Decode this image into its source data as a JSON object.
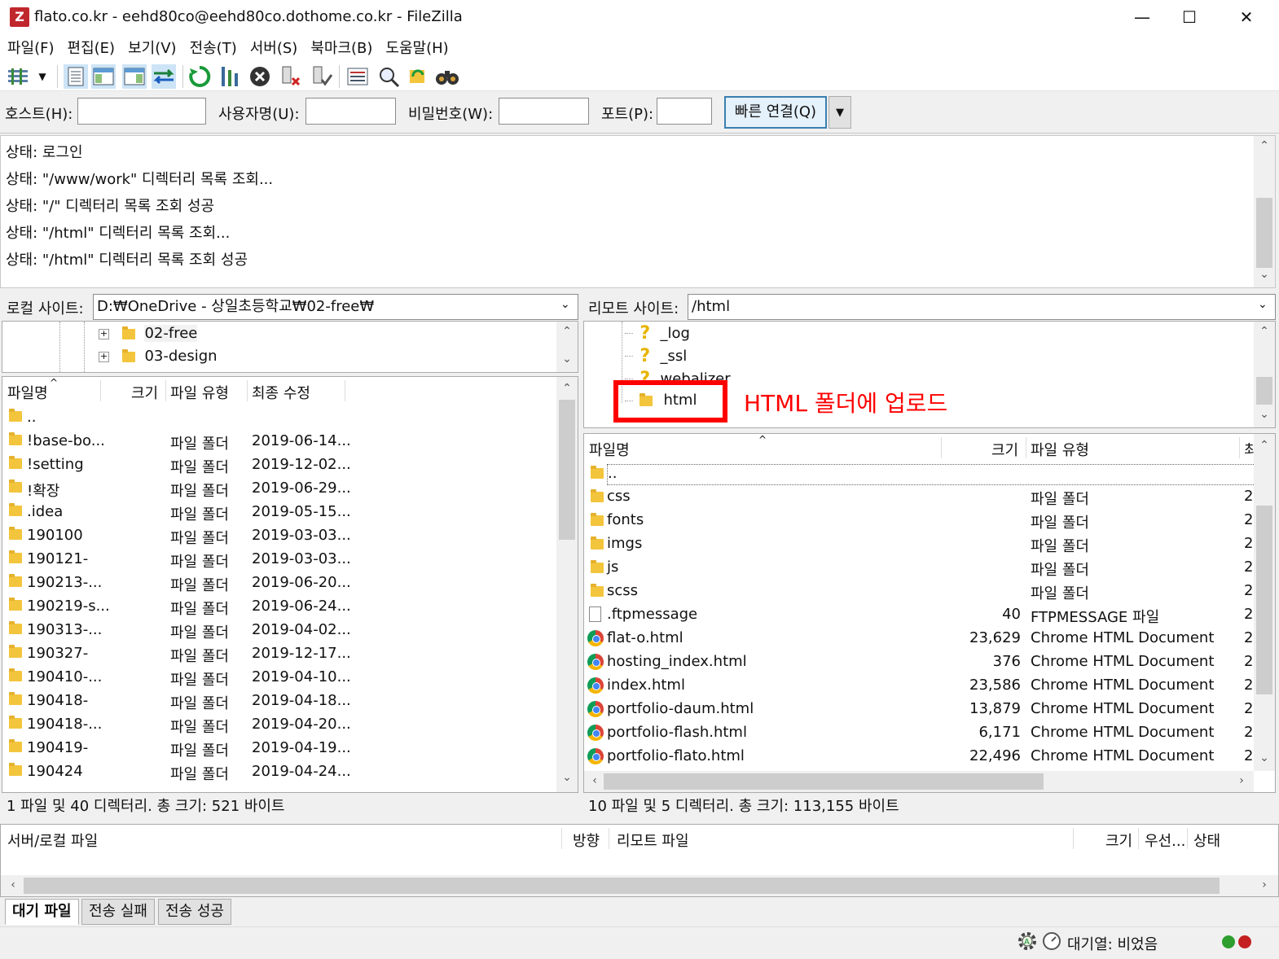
{
  "window": {
    "title": "flato.co.kr - eehd80co@eehd80co.dothome.co.kr - FileZilla",
    "app_icon": "Z",
    "minimize": "—",
    "maximize": "☐",
    "close": "✕"
  },
  "menu": [
    "파일(F)",
    "편집(E)",
    "보기(V)",
    "전송(T)",
    "서버(S)",
    "북마크(B)",
    "도움말(H)"
  ],
  "quickconnect": {
    "host_label": "호스트(H):",
    "user_label": "사용자명(U):",
    "pass_label": "비밀번호(W):",
    "port_label": "포트(P):",
    "host_value": "",
    "user_value": "",
    "pass_value": "",
    "port_value": "",
    "button_label": "빠른 연결(Q)"
  },
  "log": [
    "상태: 로그인",
    "상태: \"/www/work\" 디렉터리 목록 조회...",
    "상태: \"/\" 디렉터리 목록 조회 성공",
    "상태: \"/html\" 디렉터리 목록 조회...",
    "상태: \"/html\" 디렉터리 목록 조회 성공"
  ],
  "local": {
    "site_label": "로컬 사이트:",
    "path": "D:₩OneDrive - 상일초등학교₩02-free₩",
    "tree": [
      "02-free",
      "03-design"
    ],
    "columns": {
      "name": "파일명",
      "size": "크기",
      "type": "파일 유형",
      "modified": "최종 수정"
    },
    "rows": [
      {
        "name": "..",
        "type": "",
        "modified": ""
      },
      {
        "name": "!base-bo...",
        "type": "파일 폴더",
        "modified": "2019-06-14..."
      },
      {
        "name": "!setting",
        "type": "파일 폴더",
        "modified": "2019-12-02..."
      },
      {
        "name": "!확장",
        "type": "파일 폴더",
        "modified": "2019-06-29..."
      },
      {
        "name": ".idea",
        "type": "파일 폴더",
        "modified": "2019-05-15..."
      },
      {
        "name": "190100",
        "type": "파일 폴더",
        "modified": "2019-03-03..."
      },
      {
        "name": "190121-",
        "type": "파일 폴더",
        "modified": "2019-03-03..."
      },
      {
        "name": "190213-...",
        "type": "파일 폴더",
        "modified": "2019-06-20..."
      },
      {
        "name": "190219-s...",
        "type": "파일 폴더",
        "modified": "2019-06-24..."
      },
      {
        "name": "190313-...",
        "type": "파일 폴더",
        "modified": "2019-04-02..."
      },
      {
        "name": "190327-",
        "type": "파일 폴더",
        "modified": "2019-12-17..."
      },
      {
        "name": "190410-...",
        "type": "파일 폴더",
        "modified": "2019-04-10..."
      },
      {
        "name": "190418-",
        "type": "파일 폴더",
        "modified": "2019-04-18..."
      },
      {
        "name": "190418-...",
        "type": "파일 폴더",
        "modified": "2019-04-20..."
      },
      {
        "name": "190419-",
        "type": "파일 폴더",
        "modified": "2019-04-19..."
      },
      {
        "name": "190424",
        "type": "파일 폴더",
        "modified": "2019-04-24..."
      }
    ],
    "status": "1 파일 및 40 디렉터리. 총 크기: 521 바이트"
  },
  "remote": {
    "site_label": "리모트 사이트:",
    "path": "/html",
    "tree": [
      "_log",
      "_ssl",
      "webalizer",
      "html"
    ],
    "columns": {
      "name": "파일명",
      "size": "크기",
      "type": "파일 유형",
      "more": "최"
    },
    "rows": [
      {
        "name": "..",
        "size": "",
        "type": "",
        "icon": "folder"
      },
      {
        "name": "css",
        "size": "",
        "type": "파일 폴더",
        "icon": "folder"
      },
      {
        "name": "fonts",
        "size": "",
        "type": "파일 폴더",
        "icon": "folder"
      },
      {
        "name": "imgs",
        "size": "",
        "type": "파일 폴더",
        "icon": "folder"
      },
      {
        "name": "js",
        "size": "",
        "type": "파일 폴더",
        "icon": "folder"
      },
      {
        "name": "scss",
        "size": "",
        "type": "파일 폴더",
        "icon": "folder"
      },
      {
        "name": ".ftpmessage",
        "size": "40",
        "type": "FTPMESSAGE 파일",
        "icon": "file"
      },
      {
        "name": "flat-o.html",
        "size": "23,629",
        "type": "Chrome HTML Document",
        "icon": "chrome"
      },
      {
        "name": "hosting_index.html",
        "size": "376",
        "type": "Chrome HTML Document",
        "icon": "chrome"
      },
      {
        "name": "index.html",
        "size": "23,586",
        "type": "Chrome HTML Document",
        "icon": "chrome"
      },
      {
        "name": "portfolio-daum.html",
        "size": "13,879",
        "type": "Chrome HTML Document",
        "icon": "chrome"
      },
      {
        "name": "portfolio-flash.html",
        "size": "6,171",
        "type": "Chrome HTML Document",
        "icon": "chrome"
      },
      {
        "name": "portfolio-flato.html",
        "size": "22,496",
        "type": "Chrome HTML Document",
        "icon": "chrome"
      }
    ],
    "col_trail": "2",
    "status": "10 파일 및 5 디렉터리. 총 크기: 113,155 바이트"
  },
  "annotation": "HTML 폴더에 업로드",
  "queue": {
    "columns": {
      "server_local": "서버/로컬 파일",
      "direction": "방향",
      "remote": "리모트 파일",
      "size": "크기",
      "priority": "우선...",
      "status": "상태"
    },
    "tabs": [
      "대기 파일",
      "전송 실패",
      "전송 성공"
    ]
  },
  "statusbar": {
    "queue_text": "대기열: 비었음",
    "led_green": "#2e9e2e",
    "led_red": "#c42020"
  },
  "colors": {
    "accent": "#3c7fb1",
    "annotation": "#ff0000"
  }
}
